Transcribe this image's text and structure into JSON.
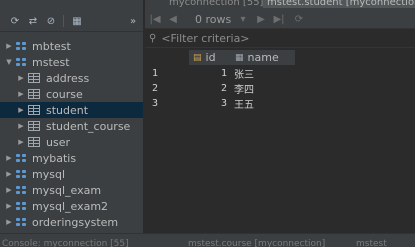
{
  "tabs": [
    {
      "label": "myconnection [55]",
      "active": false
    },
    {
      "label": "mstest.student [myconnection]",
      "active": true
    }
  ],
  "left_toolbar": {
    "icons": [
      "refresh-icon",
      "schema-sync-icon",
      "filter-icon",
      "table-view-icon",
      "more-icon"
    ]
  },
  "tree": [
    {
      "kind": "db",
      "label": "mbtest",
      "expanded": false
    },
    {
      "kind": "db",
      "label": "mstest",
      "expanded": true
    },
    {
      "kind": "table",
      "label": "address"
    },
    {
      "kind": "table",
      "label": "course"
    },
    {
      "kind": "table",
      "label": "student",
      "selected": true
    },
    {
      "kind": "table",
      "label": "student_course"
    },
    {
      "kind": "table",
      "label": "user"
    },
    {
      "kind": "db",
      "label": "mybatis",
      "expanded": false
    },
    {
      "kind": "db",
      "label": "mysql",
      "expanded": false
    },
    {
      "kind": "db",
      "label": "mysql_exam",
      "expanded": false
    },
    {
      "kind": "db",
      "label": "mysql_exam2",
      "expanded": false
    },
    {
      "kind": "db",
      "label": "orderingsystem",
      "expanded": false
    },
    {
      "kind": "db",
      "label": "",
      "expanded": false
    }
  ],
  "nav": {
    "rows_label": "0 rows"
  },
  "filter": {
    "placeholder": "<Filter criteria>"
  },
  "grid": {
    "columns": [
      "id",
      "name"
    ],
    "rows": [
      {
        "num": "1",
        "id": "1",
        "name": "张三"
      },
      {
        "num": "2",
        "id": "2",
        "name": "李四"
      },
      {
        "num": "3",
        "id": "3",
        "name": "王五"
      }
    ]
  },
  "bottom_tabs": [
    "Console: myconnection [55]",
    "mstest.course [myconnection]",
    "mstest"
  ],
  "colors": {
    "selection": "#0d293e",
    "db_icon": "#5b9bd5"
  }
}
